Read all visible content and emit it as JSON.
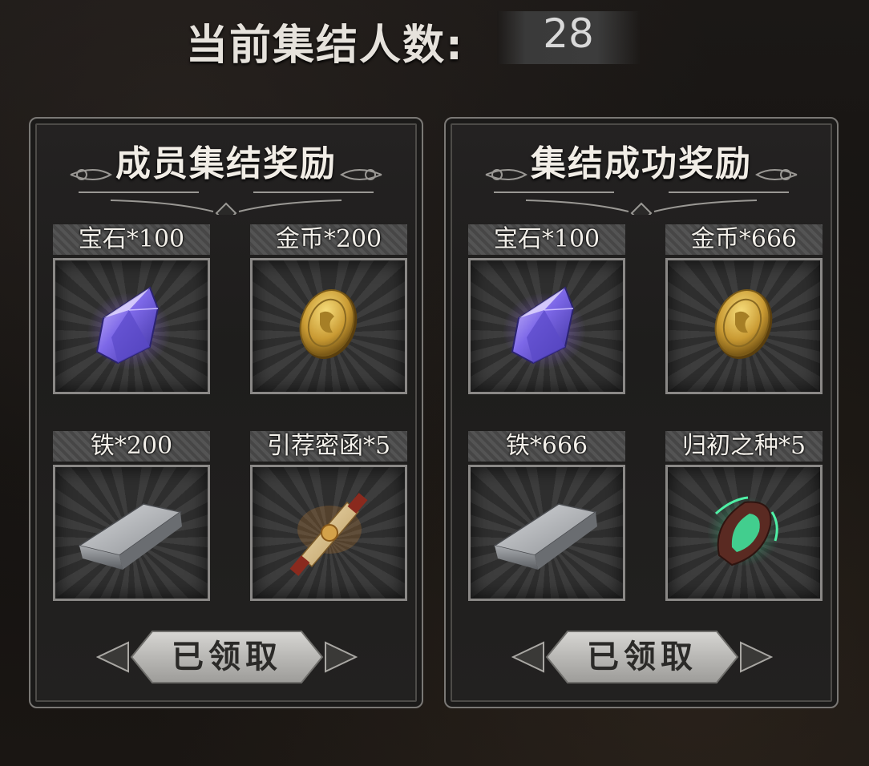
{
  "header": {
    "count_label": "当前集结人数:",
    "count_value": "28"
  },
  "panels": [
    {
      "title": "成员集结奖励",
      "items": [
        {
          "label": "宝石*100",
          "icon": "gem-icon"
        },
        {
          "label": "金币*200",
          "icon": "gold-coin-icon"
        },
        {
          "label": "铁*200",
          "icon": "iron-ingot-icon"
        },
        {
          "label": "引荐密函*5",
          "icon": "scroll-icon"
        }
      ],
      "button": "已领取"
    },
    {
      "title": "集结成功奖励",
      "items": [
        {
          "label": "宝石*100",
          "icon": "gem-icon"
        },
        {
          "label": "金币*666",
          "icon": "gold-coin-icon"
        },
        {
          "label": "铁*666",
          "icon": "iron-ingot-icon"
        },
        {
          "label": "归初之种*5",
          "icon": "seed-icon"
        }
      ],
      "button": "已领取"
    }
  ],
  "colors": {
    "panel_border": "#7a7875",
    "button": "#bdbcb9",
    "gem": "#6a5cd6",
    "gold": "#c9a040",
    "seed": "#38d68a"
  }
}
